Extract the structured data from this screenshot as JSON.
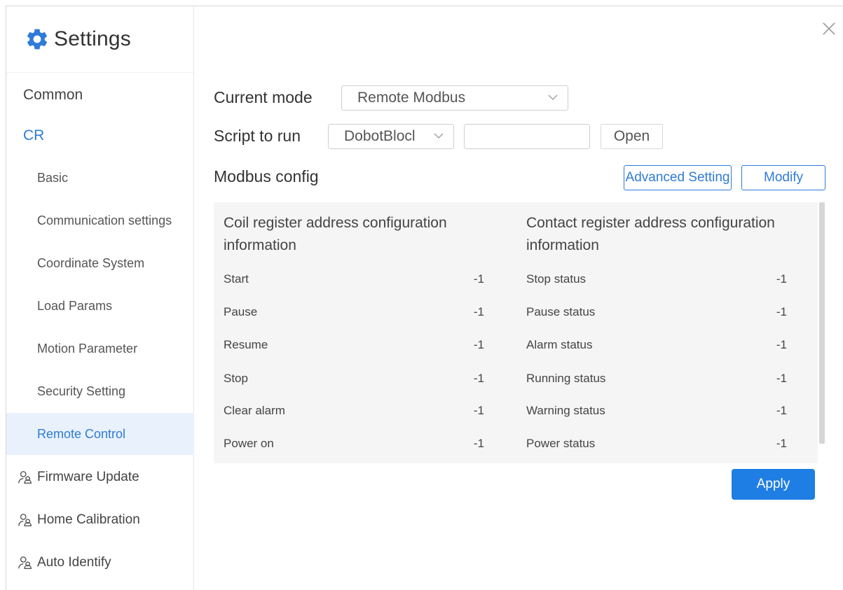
{
  "window": {
    "title": "Settings"
  },
  "sidebar": {
    "common": "Common",
    "cr": "CR",
    "sub_items": [
      "Basic",
      "Communication settings",
      "Coordinate System",
      "Load Params",
      "Motion Parameter",
      "Security Setting",
      "Remote Control"
    ],
    "icon_items": [
      "Firmware Update",
      "Home Calibration",
      "Auto Identify"
    ]
  },
  "main": {
    "current_mode_label": "Current mode",
    "current_mode_value": "Remote Modbus",
    "script_label": "Script to run",
    "script_value": "DobotBlocl",
    "script_input_value": "",
    "open_button": "Open",
    "modbus_title": "Modbus config",
    "advanced_button": "Advanced Setting",
    "modify_button": "Modify",
    "coil": {
      "header": "Coil register address configuration information",
      "rows": [
        {
          "name": "Start",
          "value": "-1"
        },
        {
          "name": "Pause",
          "value": "-1"
        },
        {
          "name": "Resume",
          "value": "-1"
        },
        {
          "name": "Stop",
          "value": "-1"
        },
        {
          "name": "Clear alarm",
          "value": "-1"
        },
        {
          "name": "Power on",
          "value": "-1"
        }
      ]
    },
    "contact": {
      "header": "Contact register address configuration information",
      "rows": [
        {
          "name": "Stop status",
          "value": "-1"
        },
        {
          "name": "Pause status",
          "value": "-1"
        },
        {
          "name": "Alarm status",
          "value": "-1"
        },
        {
          "name": "Running status",
          "value": "-1"
        },
        {
          "name": "Warning status",
          "value": "-1"
        },
        {
          "name": "Power status",
          "value": "-1"
        }
      ]
    },
    "apply_button": "Apply"
  },
  "colors": {
    "accent": "#2f7bd8",
    "primary_button": "#1e7ee3",
    "selected_bg": "#e8f1fc",
    "panel_bg": "#f5f5f5"
  },
  "icons": {
    "brand": "gear-icon",
    "close": "close-icon",
    "dropdown": "chevron-down-icon",
    "nav": "users-icon"
  }
}
